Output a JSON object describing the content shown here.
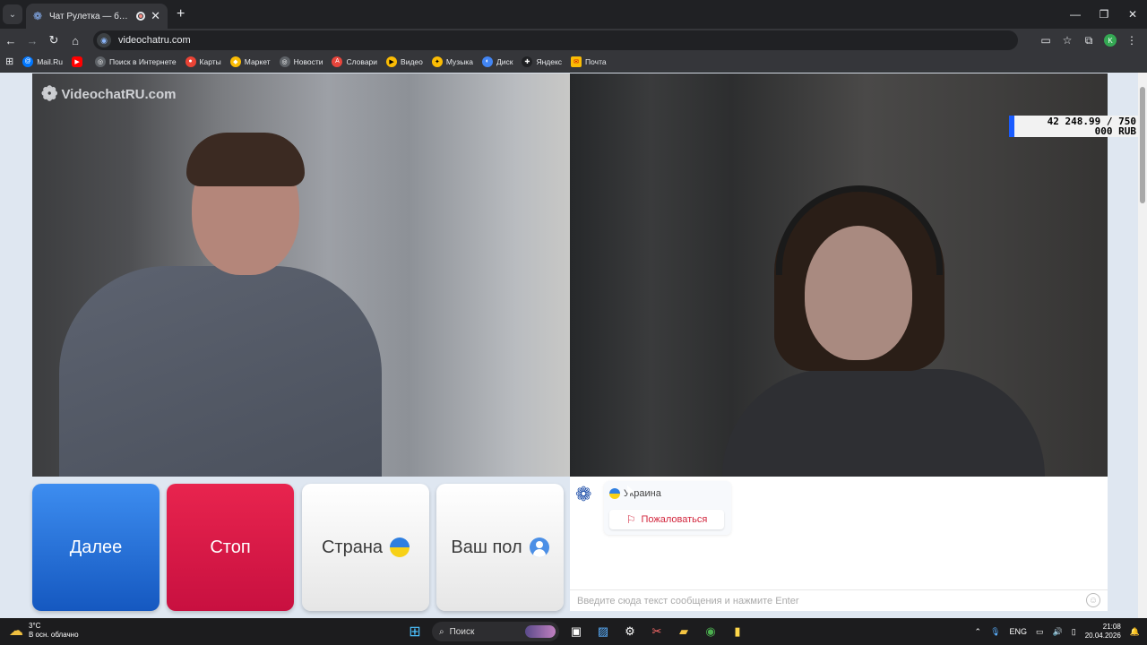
{
  "browser": {
    "tab_title": "Чат Рулетка — бесплатный видеочат",
    "url": "videochatru.com",
    "profile_initial": "K"
  },
  "bookmarks": [
    {
      "label": "Mail.Ru",
      "icon": "mailru-icon",
      "color": "#0077ff"
    },
    {
      "label": "",
      "icon": "youtube-icon",
      "color": "#ff0000"
    },
    {
      "label": "Поиск в Интернете",
      "icon": "globe-icon",
      "color": "#5f6368"
    },
    {
      "label": "Карты",
      "icon": "map-pin-icon",
      "color": "#ea4335"
    },
    {
      "label": "Маркет",
      "icon": "market-icon",
      "color": "#fbbc04"
    },
    {
      "label": "Новости",
      "icon": "globe-icon",
      "color": "#5f6368"
    },
    {
      "label": "Словари",
      "icon": "dictionary-icon",
      "color": "#e8453c"
    },
    {
      "label": "Видео",
      "icon": "play-icon",
      "color": "#fbbc04"
    },
    {
      "label": "Музыка",
      "icon": "music-icon",
      "color": "#fbbc04"
    },
    {
      "label": "Диск",
      "icon": "disk-icon",
      "color": "#4285f4"
    },
    {
      "label": "Яндекс",
      "icon": "yandex-icon",
      "color": "#202124"
    },
    {
      "label": "Почта",
      "icon": "mail-icon",
      "color": "#fbbc04"
    }
  ],
  "site": {
    "watermark": "VideochatRU.com",
    "balance": "42 248.99 / 750 000 RUB"
  },
  "controls": {
    "next": "Далее",
    "stop": "Стоп",
    "country": "Страна",
    "gender": "Ваш пол"
  },
  "chat": {
    "partner_country": "Украина",
    "report": "Пожаловаться",
    "input_placeholder": "Введите сюда текст сообщения и нажмите Enter"
  },
  "taskbar": {
    "temperature": "3°C",
    "weather_desc": "В осн. облачно",
    "search": "Поиск",
    "lang": "ENG",
    "time": "21:08",
    "date": "20.04.2026"
  },
  "colors": {
    "next_button": "#1f6fd8",
    "stop_button": "#d81a46",
    "report_text": "#d2253c"
  }
}
